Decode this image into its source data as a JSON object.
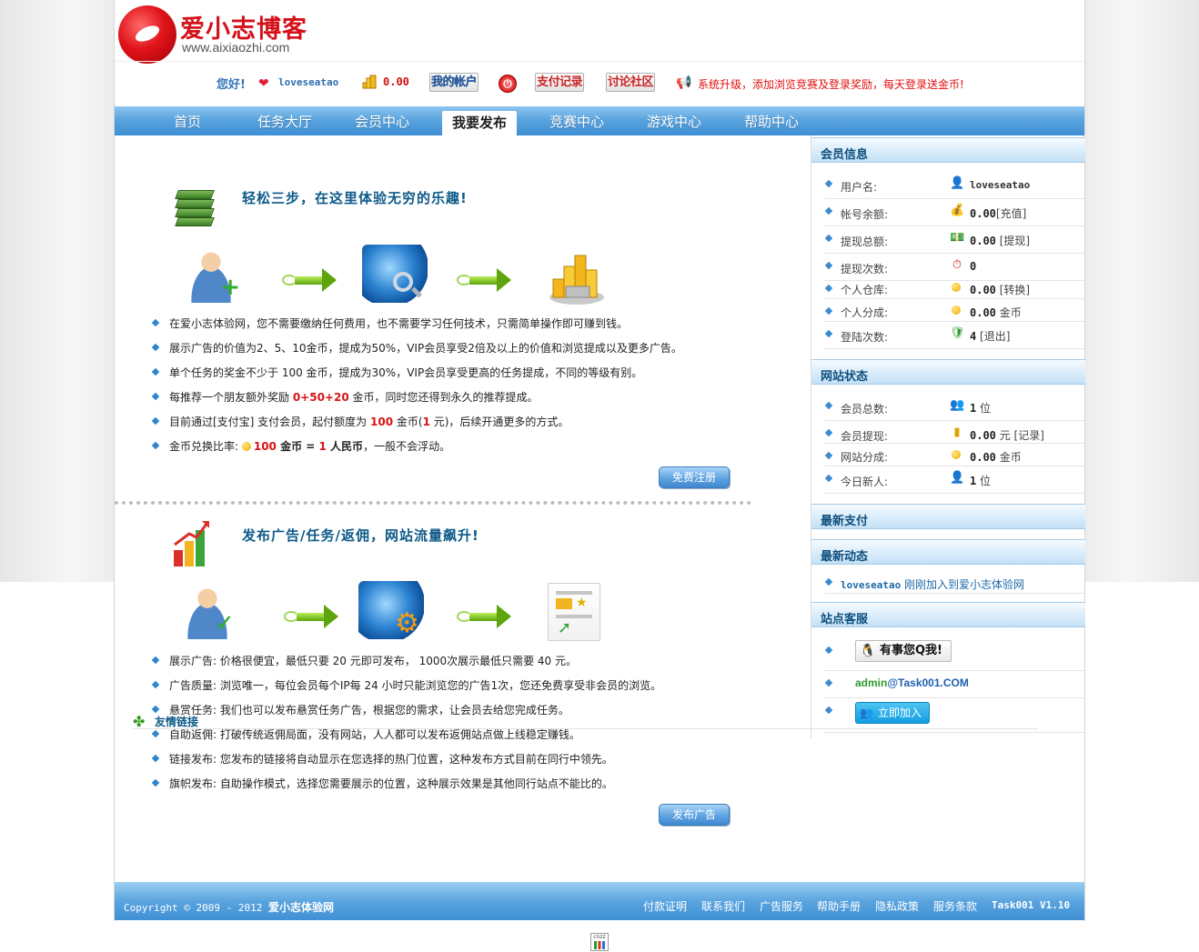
{
  "site": {
    "logo_cn": "爱小志博客",
    "logo_en": "www.aixiaozhi.com"
  },
  "userbar": {
    "greeting": "您好!",
    "username": "loveseatao",
    "gold": "0.00",
    "my_account": "我的帐户",
    "pay_records": "支付记录",
    "forum": "讨论社区",
    "notice": "系统升级，添加浏览竞赛及登录奖励，每天登录送金币!"
  },
  "nav": {
    "items": [
      "首页",
      "任务大厅",
      "会员中心",
      "我要发布",
      "竞赛中心",
      "游戏中心",
      "帮助中心"
    ],
    "active": "我要发布"
  },
  "section1": {
    "title": "轻松三步，在这里体验无穷的乐趣!",
    "items": [
      "在爱小志体验网，您不需要缴纳任何费用，也不需要学习任何技术，只需简单操作即可赚到钱。",
      "展示广告的价值为2、5、10金币，提成为50%，VIP会员享受2倍及以上的价值和浏览提成以及更多广告。",
      "单个任务的奖金不少于 100 金币，提成为30%，VIP会员享受更高的任务提成，不同的等级有别。"
    ],
    "item4_pre": "每推荐一个朋友额外奖励 ",
    "item4_red": "0+50+20",
    "item4_post": " 金币，同时您还得到永久的推荐提成。",
    "item5_pre": "目前通过[支付宝] 支付会员，起付额度为 ",
    "item5_red": "100",
    "item5_mid": " 金币(",
    "item5_red2": "1",
    "item5_post": " 元)，后续开通更多的方式。",
    "item6_pre": "金币兑换比率: ",
    "item6_red": "100",
    "item6_mid": " 金币 = ",
    "item6_red2": "1",
    "item6_mid2": " 人民币",
    "item6_post": "，一般不会浮动。",
    "button": "免费注册"
  },
  "section2": {
    "title": "发布广告/任务/返佣，网站流量飙升!",
    "items": [
      "展示广告: 价格很便宜，最低只要 20 元即可发布， 1000次展示最低只需要 40 元。",
      "广告质量: 浏览唯一，每位会员每个IP每 24 小时只能浏览您的广告1次，您还免费享受非会员的浏览。",
      "悬赏任务: 我们也可以发布悬赏任务广告，根据您的需求，让会员去给您完成任务。",
      "自助返佣: 打破传统返佣局面，没有网站，人人都可以发布返佣站点做上线稳定赚钱。",
      "链接发布: 您发布的链接将自动显示在您选择的热门位置，这种发布方式目前在同行中领先。",
      "旗帜发布: 自助操作模式，选择您需要展示的位置，这种展示效果是其他同行站点不能比的。"
    ],
    "button": "发布广告"
  },
  "friend_links": "友情链接",
  "sidebar": {
    "member_info": {
      "title": "会员信息",
      "rows": [
        {
          "label": "用户名:",
          "value": "loveseatao",
          "link": ""
        },
        {
          "label": "帐号余额:",
          "value": "0.00",
          "link": "[充值]"
        },
        {
          "label": "提现总额:",
          "value": "0.00",
          "link": " [提现]"
        },
        {
          "label": "提现次数:",
          "value": "0",
          "link": ""
        },
        {
          "label": "个人仓库:",
          "value": "0.00",
          "link": " [转换]"
        },
        {
          "label": "个人分成:",
          "value": "0.00",
          "link": " 金币"
        },
        {
          "label": "登陆次数:",
          "value": "4",
          "link": " [退出]"
        }
      ]
    },
    "site_status": {
      "title": "网站状态",
      "rows": [
        {
          "label": "会员总数:",
          "value": "1",
          "link": " 位"
        },
        {
          "label": "会员提现:",
          "value": "0.00",
          "link": " 元 [记录]"
        },
        {
          "label": "网站分成:",
          "value": "0.00",
          "link": " 金币"
        },
        {
          "label": "今日新人:",
          "value": "1",
          "link": " 位"
        }
      ]
    },
    "latest_pay": {
      "title": "最新支付"
    },
    "latest_news": {
      "title": "最新动态",
      "user": "loveseatao",
      "text": " 刚刚加入到爱小志体验网"
    },
    "service": {
      "title": "站点客服",
      "qq_label": "有事您Q我!",
      "email_user": "admin",
      "email_domain": "@Task001.COM",
      "join_label": "立即加入"
    }
  },
  "footer": {
    "copyright": "Copyright © 2009 - 2012 ",
    "site": "爱小志体验网",
    "links": [
      "付款证明",
      "联系我们",
      "广告服务",
      "帮助手册",
      "隐私政策",
      "服务条款"
    ],
    "version": "Task001 V1.10"
  },
  "colors": {
    "nav_blue": "#5aa4df",
    "accent_red": "#d81313",
    "title_teal": "#0d5a88"
  }
}
